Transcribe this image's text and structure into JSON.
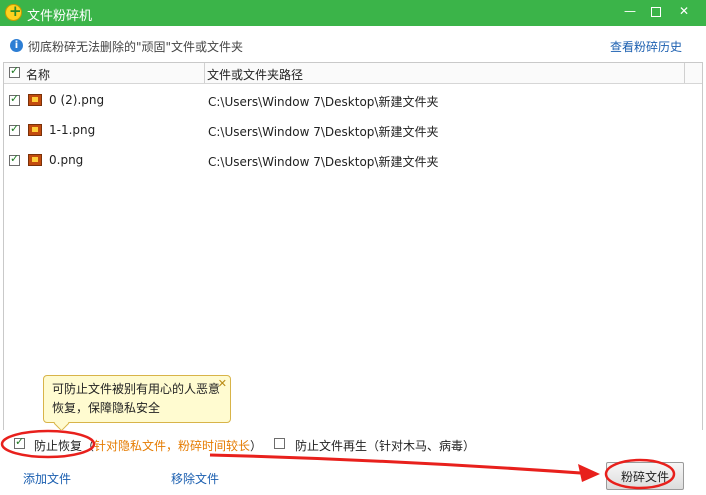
{
  "window": {
    "title": "文件粉碎机"
  },
  "info": {
    "message": "彻底粉碎无法删除的\"顽固\"文件或文件夹",
    "history_link": "查看粉碎历史"
  },
  "table": {
    "columns": [
      "名称",
      "文件或文件夹路径"
    ],
    "rows": [
      {
        "name": "0 (2).png",
        "path": "C:\\Users\\Window 7\\Desktop\\新建文件夹",
        "checked": true
      },
      {
        "name": "1-1.png",
        "path": "C:\\Users\\Window 7\\Desktop\\新建文件夹",
        "checked": true
      },
      {
        "name": "0.png",
        "path": "C:\\Users\\Window 7\\Desktop\\新建文件夹",
        "checked": true
      }
    ]
  },
  "tooltip": {
    "line1": "可防止文件被别有用心的人恶意",
    "line2": "恢复，保障隐私安全"
  },
  "options": {
    "prevent_recovery": {
      "label": "防止恢复（",
      "note": "针对隐私文件，粉碎时间较长",
      "end": "）",
      "checked": true
    },
    "prevent_regen": {
      "label": "防止文件再生（针对木马、病毒）",
      "checked": false
    }
  },
  "bottom": {
    "add_files": "添加文件",
    "remove_files": "移除文件",
    "shred_button": "粉碎文件"
  },
  "colors": {
    "titlebar": "#3bb449",
    "annotation": "#e8201c",
    "warning_text": "#e57b00",
    "link": "#1b5fb0"
  }
}
